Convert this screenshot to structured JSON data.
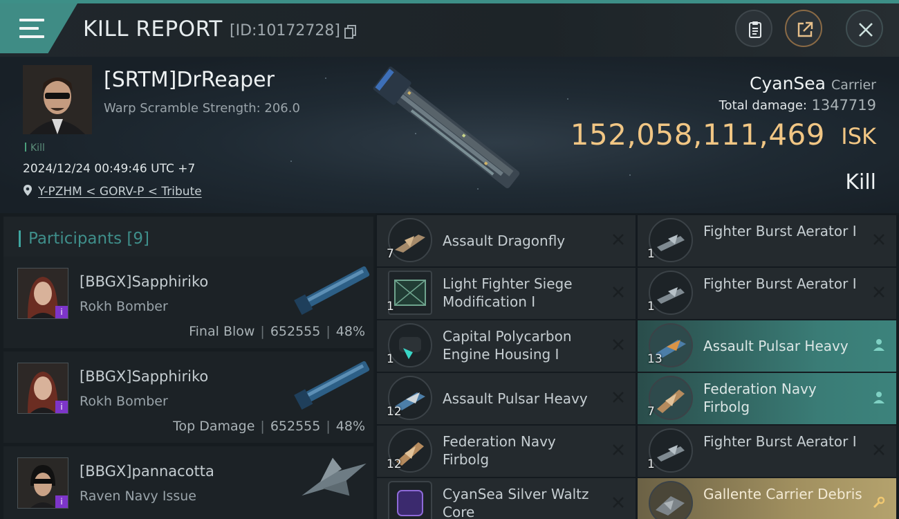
{
  "header": {
    "title": "KILL REPORT",
    "report_id": "[ID:10172728]"
  },
  "victim": {
    "name": "[SRTM]DrReaper",
    "warp_scramble": "Warp Scramble Strength: 206.0",
    "tag": "Kill",
    "timestamp": "2024/12/24 00:49:46 UTC +7",
    "location": "Y-PZHM < GORV-P < Tribute",
    "ship_name": "CyanSea",
    "ship_class": "Carrier",
    "total_damage_label": "Total damage:",
    "total_damage": "1347719",
    "isk_value": "152,058,111,469",
    "isk_unit": "ISK",
    "result": "Kill"
  },
  "participants": {
    "title": "Participants",
    "count": "[9]",
    "list": [
      {
        "name": "[BBGX]Sapphiriko",
        "ship": "Rokh Bomber",
        "role": "Final Blow",
        "damage": "652555",
        "percent": "48%",
        "badge": "i"
      },
      {
        "name": "[BBGX]Sapphiriko",
        "ship": "Rokh Bomber",
        "role": "Top Damage",
        "damage": "652555",
        "percent": "48%",
        "badge": "i"
      },
      {
        "name": "[BBGX]pannacotta",
        "ship": "Raven Navy Issue",
        "role": "",
        "damage": "",
        "percent": "",
        "badge": "i"
      }
    ]
  },
  "items": [
    {
      "name": "Assault Dragonfly",
      "qty": "7",
      "status": "destroyed"
    },
    {
      "name": "Fighter Burst Aerator I",
      "qty": "1",
      "status": "destroyed"
    },
    {
      "name": "Light Fighter Siege Modification I",
      "qty": "1",
      "status": "destroyed"
    },
    {
      "name": "Fighter Burst Aerator I",
      "qty": "1",
      "status": "destroyed"
    },
    {
      "name": "Capital Polycarbon Engine Housing I",
      "qty": "1",
      "status": "destroyed"
    },
    {
      "name": "Assault Pulsar Heavy",
      "qty": "13",
      "status": "used"
    },
    {
      "name": "Assault Pulsar Heavy",
      "qty": "12",
      "status": "destroyed"
    },
    {
      "name": "Federation Navy Firbolg",
      "qty": "7",
      "status": "used"
    },
    {
      "name": "Federation Navy Firbolg",
      "qty": "12",
      "status": "destroyed"
    },
    {
      "name": "Fighter Burst Aerator I",
      "qty": "1",
      "status": "destroyed"
    },
    {
      "name": "CyanSea Silver Waltz Core",
      "qty": "",
      "status": "destroyed"
    },
    {
      "name": "Gallente Carrier Debris",
      "qty": "",
      "status": "dropped"
    }
  ],
  "colors": {
    "accent": "#3f8c85",
    "isk": "#f1c684",
    "used_item": "#3a7c76",
    "dropped_item": "#a08f5f"
  }
}
